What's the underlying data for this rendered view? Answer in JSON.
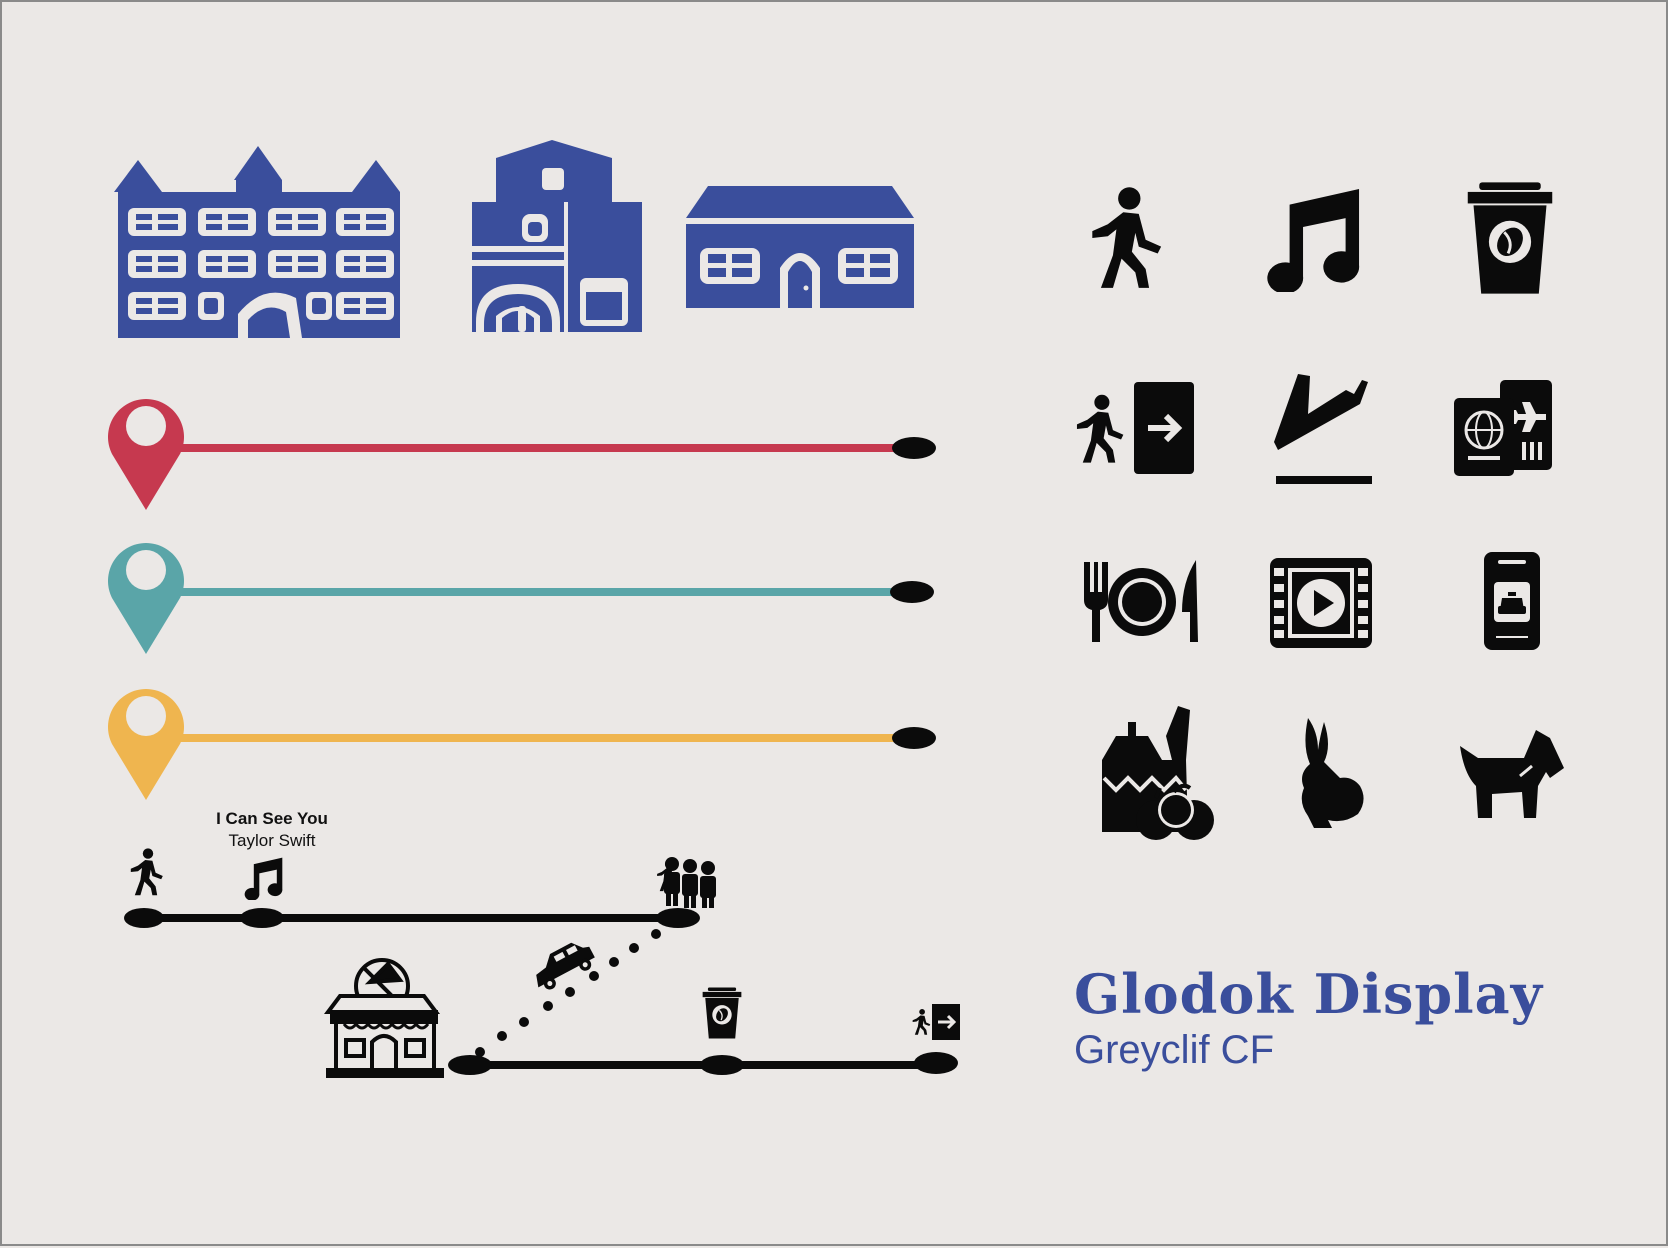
{
  "song": {
    "title": "I Can See You",
    "artist": "Taylor Swift"
  },
  "brand": {
    "display_font": "Glodok Display",
    "body_font": "Greyclif CF"
  },
  "colors": {
    "background": "#ebe8e6",
    "building_blue": "#3a4e9c",
    "pin_red": "#c6394f",
    "pin_teal": "#5aa5a8",
    "pin_yellow": "#efb54f",
    "ink": "#0b0b0b"
  },
  "icons": {
    "buildings": [
      "castle-building-icon",
      "tall-house-icon",
      "house-icon"
    ],
    "grid": [
      "walking-person-icon",
      "music-note-icon",
      "coffee-cup-icon",
      "exit-door-icon",
      "airplane-landing-icon",
      "passport-ticket-icon",
      "restaurant-icon",
      "video-play-icon",
      "taxi-app-icon",
      "groceries-icon",
      "rabbit-icon",
      "dog-icon"
    ],
    "timeline": [
      "walking-person-icon",
      "music-note-icon",
      "crowd-icon",
      "pizza-shop-icon",
      "car-icon",
      "coffee-cup-icon",
      "exit-door-icon"
    ]
  }
}
